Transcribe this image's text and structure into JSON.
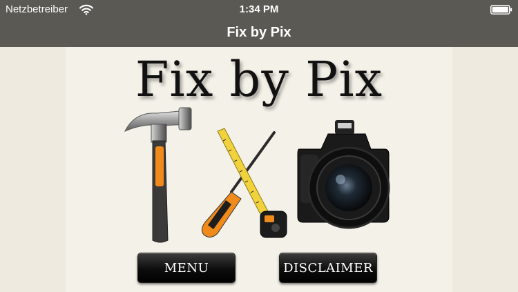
{
  "status_bar": {
    "carrier": "Netzbetreiber",
    "time": "1:34 PM",
    "icons": [
      "wifi-icon",
      "battery-icon"
    ]
  },
  "nav_bar": {
    "title": "Fix by Pix"
  },
  "main": {
    "logo_text": "Fix by Pix",
    "artwork": [
      "hammer",
      "screwdriver",
      "tape-measure",
      "camera"
    ],
    "buttons": {
      "menu": "MENU",
      "disclaimer": "DISCLAIMER"
    }
  },
  "colors": {
    "bar_background": "#5b5954",
    "content_background": "#f4f1e8",
    "button_background": "#0d0d0d",
    "hammer_grip_accent": "#f08a1a"
  }
}
